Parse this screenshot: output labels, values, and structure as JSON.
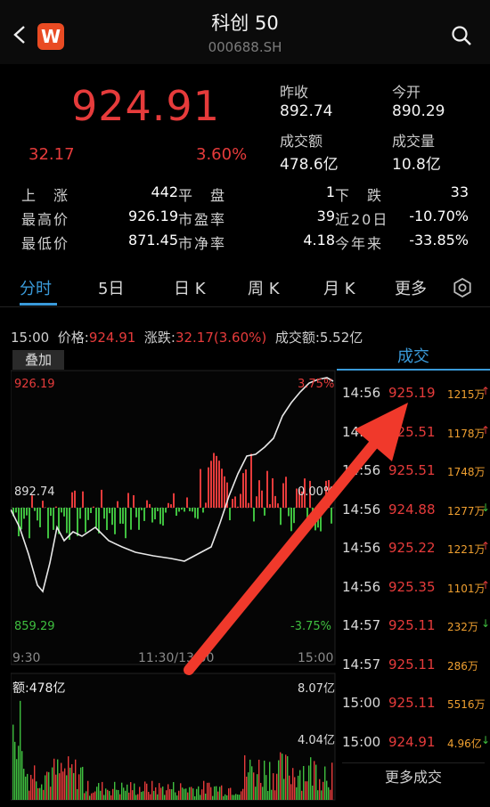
{
  "header": {
    "title": "科创 50",
    "code": "000688.SH",
    "logo_text": "W"
  },
  "quote": {
    "price": "924.91",
    "change": "32.17",
    "change_pct": "3.60%",
    "prev_close_label": "昨收",
    "prev_close": "892.74",
    "open_label": "今开",
    "open": "890.29",
    "turnover_label": "成交额",
    "turnover": "478.6亿",
    "volume_label": "成交量",
    "volume": "10.8亿"
  },
  "stats": {
    "up_label": "上　涨",
    "up": "442",
    "flat_label": "平　盘",
    "flat": "1",
    "down_label": "下　跌",
    "down": "33",
    "high_label": "最高价",
    "high": "926.19",
    "pe_label": "市盈率",
    "pe": "39",
    "d20_label": "近20日",
    "d20": "-10.70%",
    "low_label": "最低价",
    "low": "871.45",
    "pb_label": "市净率",
    "pb": "4.18",
    "ytd_label": "今年来",
    "ytd": "-33.85%"
  },
  "tabs": [
    {
      "label": "分时"
    },
    {
      "label": "5日"
    },
    {
      "label": "日 K"
    },
    {
      "label": "周 K"
    },
    {
      "label": "月 K"
    },
    {
      "label": "更多"
    }
  ],
  "info_line": {
    "time": "15:00",
    "price_label": "价格:",
    "price": "924.91",
    "change_label": "涨跌:",
    "change": "32.17(3.60%)",
    "amount_label": "成交额:",
    "amount": "5.52亿"
  },
  "chart": {
    "overlay_label": "叠加",
    "y_high": "926.19",
    "y_mid": "892.74",
    "y_low": "859.29",
    "pct_high": "3.75%",
    "pct_mid": "0.00%",
    "pct_low": "-3.75%",
    "x_start": "9:30",
    "x_mid": "11:30/13:00",
    "x_end": "15:00",
    "vol_label": "额:478亿",
    "vol_max": "8.07亿",
    "vol_mid": "4.04亿"
  },
  "trades": {
    "title": "成交",
    "rows": [
      {
        "time": "14:56",
        "price": "925.19",
        "vol": "1215万",
        "dir": "up"
      },
      {
        "time": "14:56",
        "price": "925.51",
        "vol": "1178万",
        "dir": "up"
      },
      {
        "time": "14:56",
        "price": "925.51",
        "vol": "1748万",
        "dir": "none"
      },
      {
        "time": "14:56",
        "price": "924.88",
        "vol": "1277万",
        "dir": "down"
      },
      {
        "time": "14:56",
        "price": "925.22",
        "vol": "1221万",
        "dir": "up"
      },
      {
        "time": "14:56",
        "price": "925.35",
        "vol": "1101万",
        "dir": "up"
      },
      {
        "time": "14:57",
        "price": "925.11",
        "vol": "232万",
        "dir": "down"
      },
      {
        "time": "14:57",
        "price": "925.11",
        "vol": "286万",
        "dir": "none"
      },
      {
        "time": "15:00",
        "price": "925.11",
        "vol": "5516万",
        "dir": "none"
      },
      {
        "time": "15:00",
        "price": "924.91",
        "vol": "4.96亿",
        "dir": "down"
      }
    ],
    "more_label": "更多成交"
  },
  "colors": {
    "up": "#e63b3b",
    "down": "#3fbf3f",
    "accent": "#3a9ad9",
    "arrow": "#f0392b"
  },
  "icons": {
    "back": "chevron-left-icon",
    "search": "search-icon",
    "settings": "gear-icon",
    "annotation": "red-arrow-icon"
  }
}
